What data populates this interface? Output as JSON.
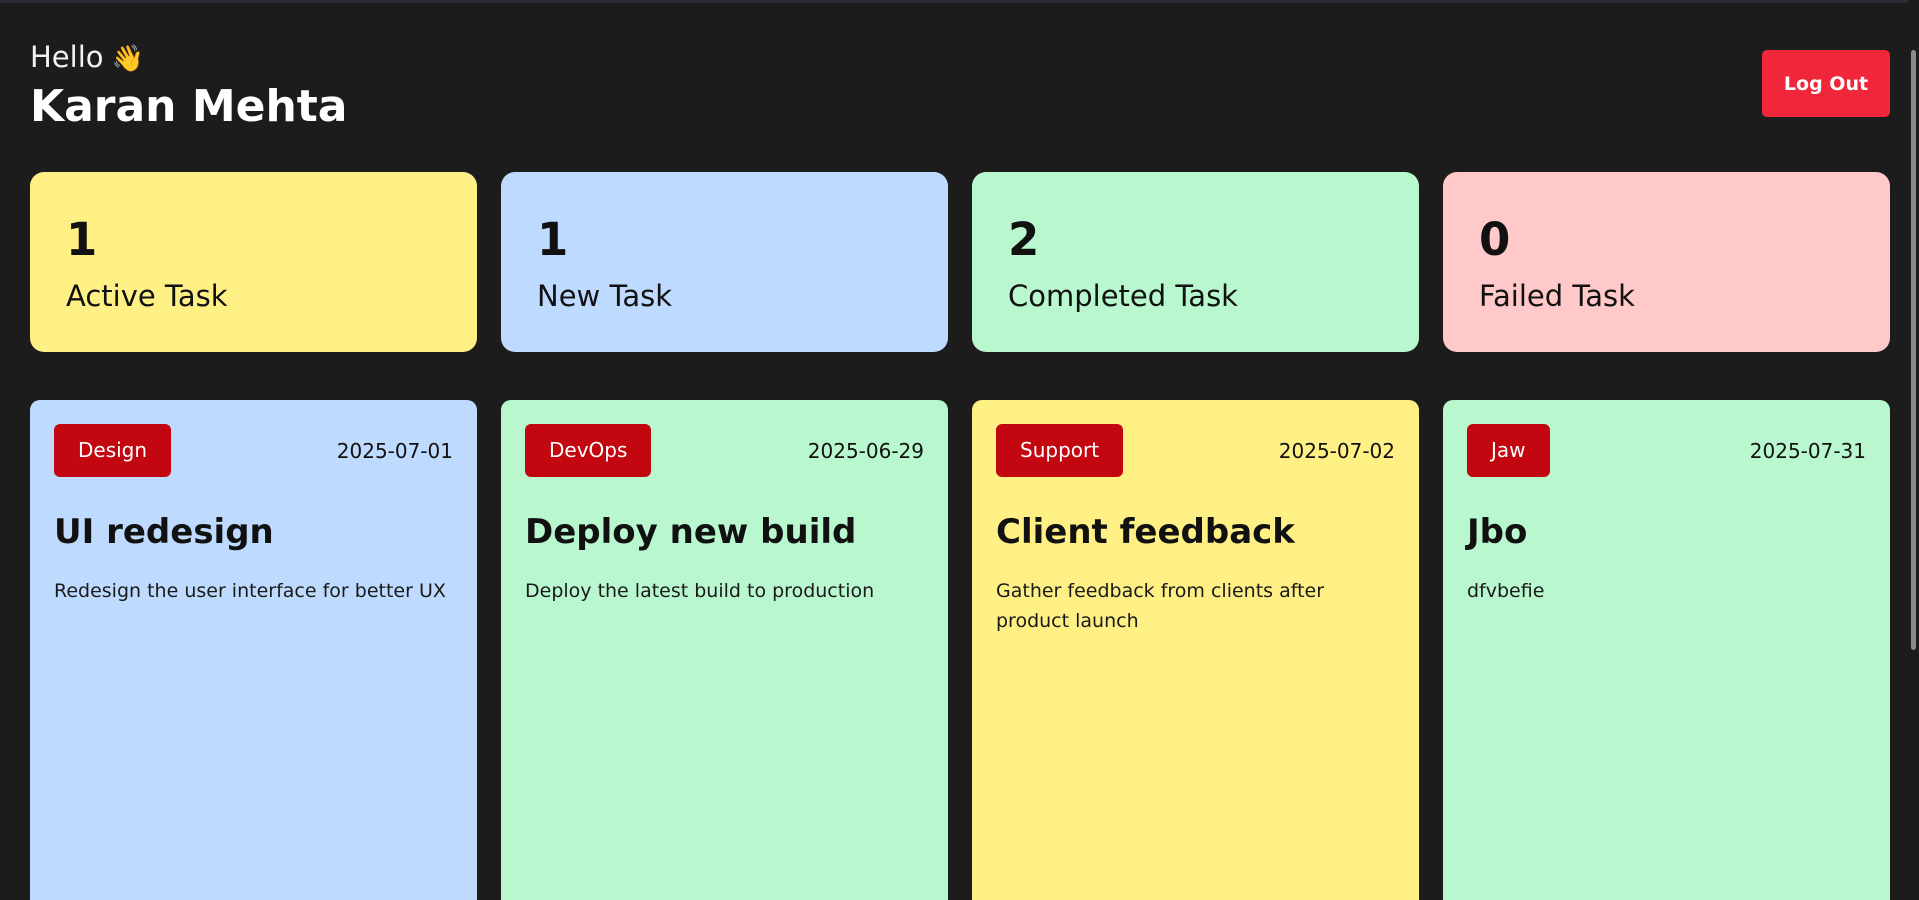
{
  "header": {
    "greeting": "Hello",
    "wave_icon": "👋",
    "user_name": "Karan Mehta",
    "logout_label": "Log Out"
  },
  "colors": {
    "background": "#1c1c1c",
    "logout": "#f0263a",
    "badge": "#c20710",
    "yellow": "#fff085",
    "blue": "#bedbff",
    "green": "#b9f8cf",
    "red": "#ffc9c9"
  },
  "stats": [
    {
      "count": "1",
      "label": "Active Task",
      "color": "#fff085"
    },
    {
      "count": "1",
      "label": "New Task",
      "color": "#bedbff"
    },
    {
      "count": "2",
      "label": "Completed Task",
      "color": "#b9f8cf"
    },
    {
      "count": "0",
      "label": "Failed Task",
      "color": "#ffc9c9"
    }
  ],
  "tasks": [
    {
      "category": "Design",
      "date": "2025-07-01",
      "title": "UI redesign",
      "description": "Redesign the user interface for better UX",
      "color": "#bedbff"
    },
    {
      "category": "DevOps",
      "date": "2025-06-29",
      "title": "Deploy new build",
      "description": "Deploy the latest build to production",
      "color": "#b9f8cf"
    },
    {
      "category": "Support",
      "date": "2025-07-02",
      "title": "Client feedback",
      "description": "Gather feedback from clients after product launch",
      "color": "#fff085"
    },
    {
      "category": "Jaw",
      "date": "2025-07-31",
      "title": "Jbo",
      "description": "dfvbefie",
      "color": "#b9f8cf"
    }
  ]
}
